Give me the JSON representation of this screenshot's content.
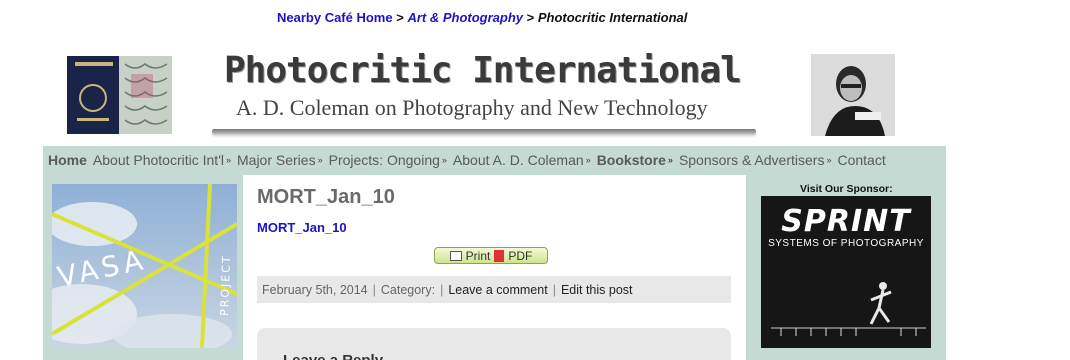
{
  "breadcrumb": {
    "home": "Nearby Café Home",
    "sep1": ">",
    "category": "Art & Photography",
    "sep2": ">",
    "current": "Photocritic International"
  },
  "header": {
    "title": "Photocritic International",
    "tagline": "A. D. Coleman on Photography and New Technology"
  },
  "nav": {
    "items": [
      {
        "label": "Home",
        "dropdown": false
      },
      {
        "label": "About Photocritic Int'l",
        "dropdown": true
      },
      {
        "label": "Major Series",
        "dropdown": true
      },
      {
        "label": "Projects: Ongoing",
        "dropdown": true
      },
      {
        "label": "About A. D. Coleman",
        "dropdown": true
      },
      {
        "label": "Bookstore",
        "dropdown": true
      },
      {
        "label": "Sponsors & Advertisers",
        "dropdown": true
      },
      {
        "label": "Contact",
        "dropdown": false
      }
    ],
    "chevron_glyph": "»"
  },
  "vasa": {
    "word": "VASA",
    "sub": "PROJECT"
  },
  "post": {
    "title": "MORT_Jan_10",
    "link": "MORT_Jan_10",
    "print_label": "Print",
    "pdf_label": "PDF",
    "meta": {
      "date": "February 5th, 2014",
      "category": "Category:",
      "comment": "Leave a comment",
      "edit": "Edit this post"
    },
    "comments_heading": "Leave a Reply"
  },
  "sponsor": {
    "label": "Visit Our Sponsor:",
    "brand": "SPRINT",
    "tagline": "SYSTEMS OF PHOTOGRAPHY"
  },
  "colors": {
    "nav_bg": "#c5dad3",
    "link": "#1d12c8",
    "meta_bg": "#e8e8e8"
  }
}
